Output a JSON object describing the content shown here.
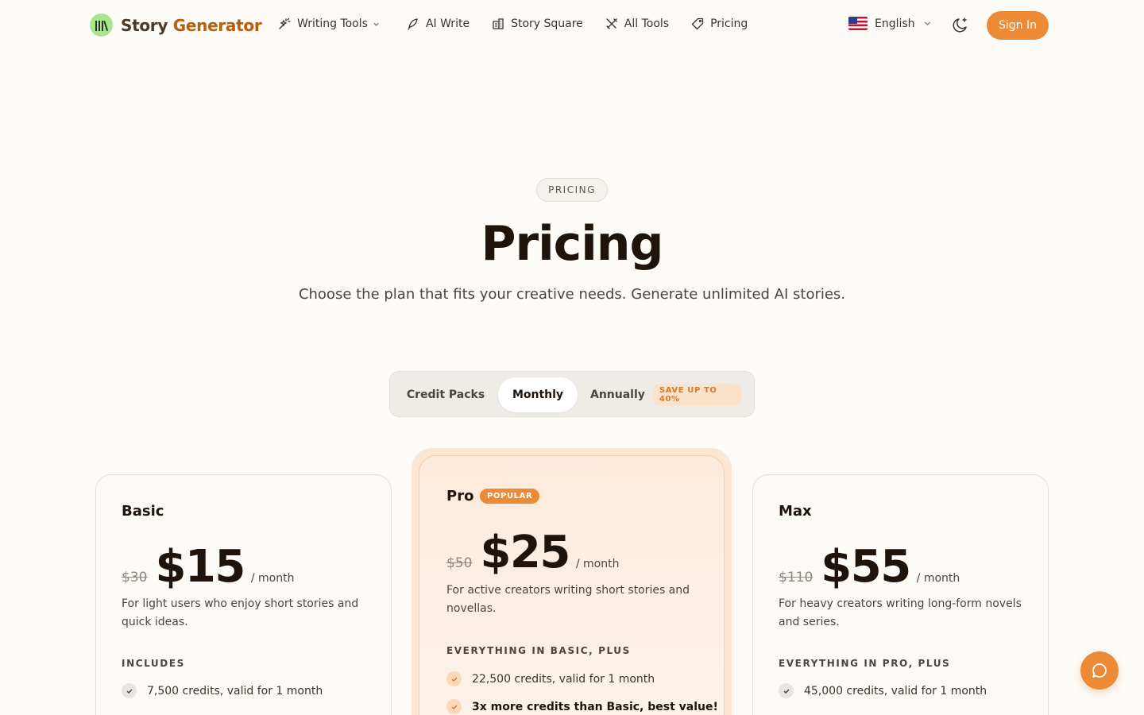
{
  "brand": {
    "name_part1": "Story ",
    "name_part2": "Generator"
  },
  "nav": {
    "items": [
      {
        "label": "Writing Tools"
      },
      {
        "label": "AI Write"
      },
      {
        "label": "Story Square"
      },
      {
        "label": "All Tools"
      },
      {
        "label": "Pricing"
      }
    ]
  },
  "language": {
    "label": "English"
  },
  "signin": {
    "label": "Sign In"
  },
  "hero": {
    "eyebrow": "PRICING",
    "title": "Pricing",
    "subtitle": "Choose the plan that fits your creative needs. Generate unlimited AI stories."
  },
  "billing_toggle": {
    "options": [
      {
        "label": "Credit Packs"
      },
      {
        "label": "Monthly"
      },
      {
        "label": "Annually"
      }
    ],
    "selected": "Monthly",
    "save_badge": "SAVE UP TO 40%"
  },
  "plans": [
    {
      "name": "Basic",
      "old_price": "$30",
      "price": "$15",
      "period": "/ month",
      "description": "For light users who enjoy short stories and quick ideas.",
      "includes_label": "INCLUDES",
      "features": [
        "7,500 credits, valid for 1 month"
      ]
    },
    {
      "name": "Pro",
      "badge": "POPULAR",
      "old_price": "$50",
      "price": "$25",
      "period": "/ month",
      "description": "For active creators writing short stories and novellas.",
      "includes_label": "EVERYTHING IN BASIC, PLUS",
      "features": [
        "22,500 credits, valid for 1 month",
        "3x more credits than Basic, best value!"
      ]
    },
    {
      "name": "Max",
      "old_price": "$110",
      "price": "$55",
      "period": "/ month",
      "description": "For heavy creators writing long-form novels and series.",
      "includes_label": "EVERYTHING IN PRO, PLUS",
      "features": [
        "45,000 credits, valid for 1 month"
      ]
    }
  ],
  "colors": {
    "accent": "#ec8a36",
    "background": "#fcfbf8",
    "brand_green": "#a9e48f",
    "brand_orange": "#b65f0f"
  },
  "icons": {
    "logo": "books-icon",
    "writing_tools": "magic-wand-icon",
    "ai_write": "feather-icon",
    "story_square": "building-icon",
    "all_tools": "tools-icon",
    "pricing": "tag-icon",
    "language": "us-flag-icon",
    "theme": "moon-sparkle-icon",
    "chat": "chat-bubble-icon",
    "check": "check-icon"
  }
}
